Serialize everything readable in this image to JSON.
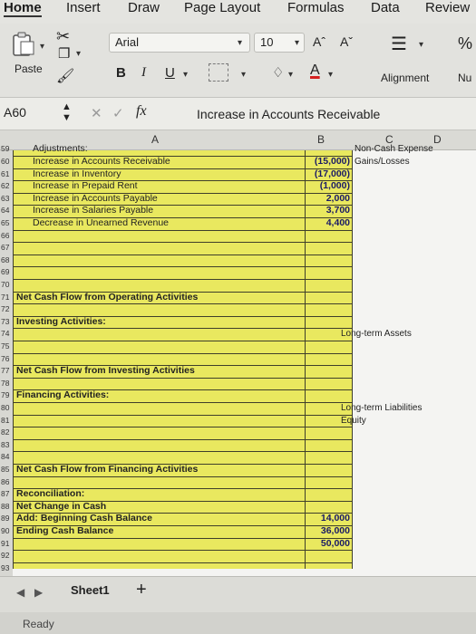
{
  "ribbon_tabs": [
    "Home",
    "Insert",
    "Draw",
    "Page Layout",
    "Formulas",
    "Data",
    "Review"
  ],
  "ribbon": {
    "paste_label": "Paste",
    "font_name": "Arial",
    "font_size": "10",
    "bold": "B",
    "italic": "I",
    "underline": "U",
    "grow_font": "Aˆ",
    "shrink_font": "Aˇ",
    "alignment_label": "Alignment",
    "number_label": "Nu"
  },
  "formula_bar": {
    "name_box": "A60",
    "fx": "fx",
    "content": "Increase in Accounts Receivable"
  },
  "columns": [
    "A",
    "B",
    "C",
    "D"
  ],
  "sheet": {
    "top_partial": {
      "row": "59",
      "a": "Adjustments:",
      "c": "Non-Cash Expense"
    },
    "rows": [
      {
        "num": "60",
        "a": "Increase in Accounts Receivable",
        "b": "(15,000)",
        "c": "Gains/Losses"
      },
      {
        "num": "61",
        "a": "Increase in Inventory",
        "b": "(17,000)",
        "c": ""
      },
      {
        "num": "62",
        "a": "Increase in Prepaid Rent",
        "b": "(1,000)",
        "c": ""
      },
      {
        "num": "63",
        "a": "Increase in Accounts Payable",
        "b": "2,000",
        "c": ""
      },
      {
        "num": "64",
        "a": "Increase in Salaries Payable",
        "b": "3,700",
        "c": ""
      },
      {
        "num": "65",
        "a": "Decrease in Unearned Revenue",
        "b": "4,400",
        "c": ""
      },
      {
        "num": "66",
        "a": "",
        "b": "",
        "c": ""
      },
      {
        "num": "67",
        "a": "",
        "b": "",
        "c": ""
      },
      {
        "num": "68",
        "a": "",
        "b": "",
        "c": ""
      },
      {
        "num": "69",
        "a": "",
        "b": "",
        "c": ""
      },
      {
        "num": "70",
        "a": "",
        "b": "",
        "c": ""
      },
      {
        "num": "71",
        "a": "Net Cash Flow from Operating Activities",
        "b": "",
        "c": ""
      },
      {
        "num": "72",
        "a": "",
        "b": "",
        "c": ""
      },
      {
        "num": "73",
        "a": "Investing Activities:",
        "b": "",
        "c": ""
      },
      {
        "num": "74",
        "a": "",
        "b": "",
        "c": "Long-term Assets"
      },
      {
        "num": "75",
        "a": "",
        "b": "",
        "c": ""
      },
      {
        "num": "76",
        "a": "",
        "b": "",
        "c": ""
      },
      {
        "num": "77",
        "a": "Net Cash Flow from Investing Activities",
        "b": "",
        "c": ""
      },
      {
        "num": "78",
        "a": "",
        "b": "",
        "c": ""
      },
      {
        "num": "79",
        "a": "Financing Activities:",
        "b": "",
        "c": ""
      },
      {
        "num": "80",
        "a": "",
        "b": "",
        "c": "Long-term Liabilities"
      },
      {
        "num": "81",
        "a": "",
        "b": "",
        "c": "Equity"
      },
      {
        "num": "82",
        "a": "",
        "b": "",
        "c": ""
      },
      {
        "num": "83",
        "a": "",
        "b": "",
        "c": ""
      },
      {
        "num": "84",
        "a": "",
        "b": "",
        "c": ""
      },
      {
        "num": "85",
        "a": "Net Cash Flow from Financing Activities",
        "b": "",
        "c": ""
      },
      {
        "num": "86",
        "a": "",
        "b": "",
        "c": ""
      },
      {
        "num": "87",
        "a": "Reconciliation:",
        "b": "",
        "c": ""
      },
      {
        "num": "88",
        "a": "Net Change in Cash",
        "b": "",
        "c": ""
      },
      {
        "num": "89",
        "a": "Add: Beginning Cash Balance",
        "b": "14,000",
        "c": ""
      },
      {
        "num": "90",
        "a": "Ending Cash Balance",
        "b": "36,000",
        "c": ""
      },
      {
        "num": "91",
        "a": "",
        "b": "50,000",
        "c": ""
      },
      {
        "num": "92",
        "a": "",
        "b": "",
        "c": ""
      },
      {
        "num": "93",
        "a": "",
        "b": "",
        "c": ""
      }
    ]
  },
  "sheet_tabs": [
    "Sheet1"
  ],
  "add_sheet": "+",
  "status": "Ready",
  "colors": {
    "highlight": "#e9e85f",
    "value_text": "#1a1a66"
  }
}
